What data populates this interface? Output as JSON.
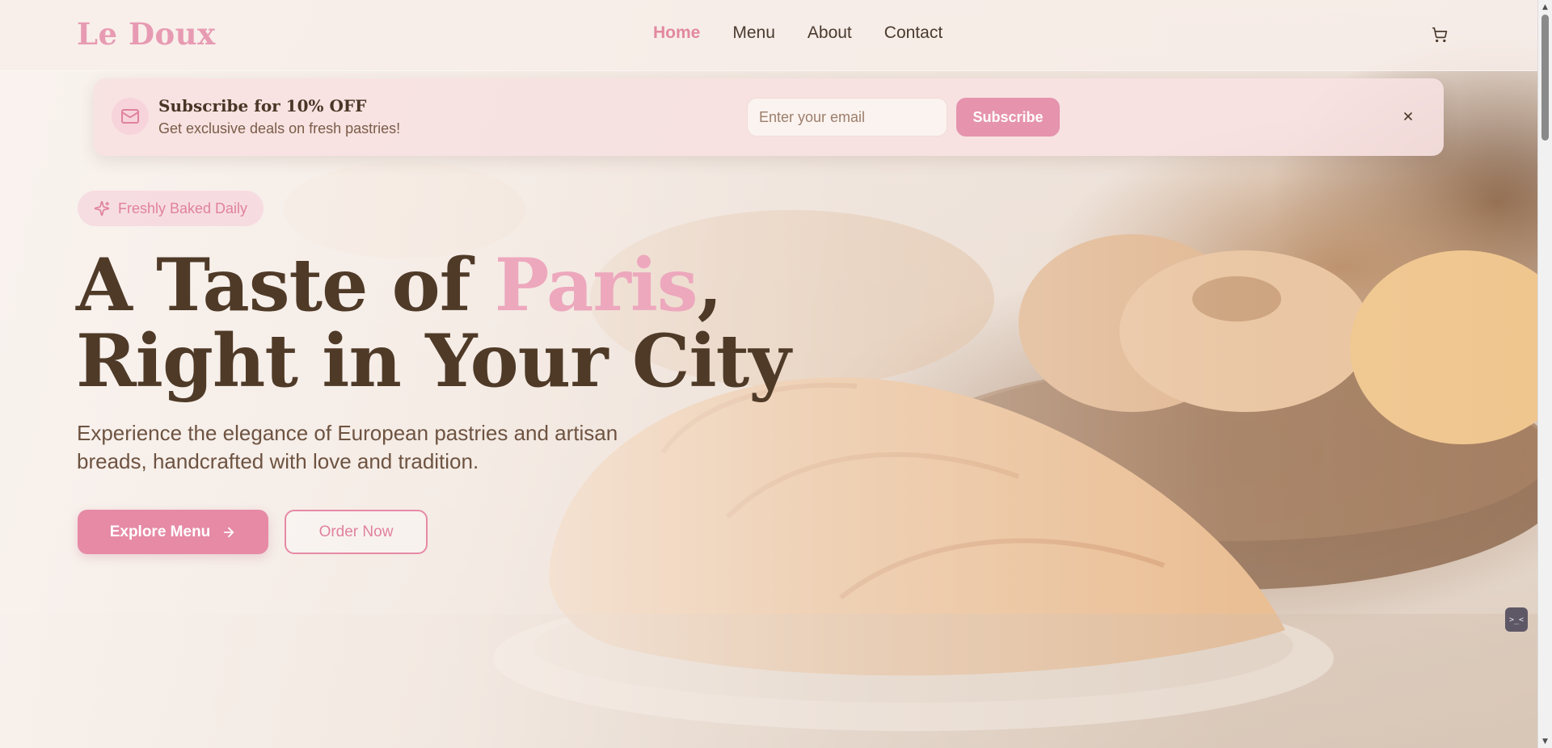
{
  "brand": {
    "logo": "Le Doux",
    "accent_color": "#e68aa6",
    "text_color": "#4f3a28"
  },
  "nav": {
    "items": [
      {
        "label": "Home",
        "active": true
      },
      {
        "label": "Menu",
        "active": false
      },
      {
        "label": "About",
        "active": false
      },
      {
        "label": "Contact",
        "active": false
      }
    ],
    "cart_icon": "shopping-cart-icon"
  },
  "banner": {
    "icon": "mail-icon",
    "title": "Subscribe for 10% OFF",
    "subtitle": "Get exclusive deals on fresh pastries!",
    "email_placeholder": "Enter your email",
    "email_value": "",
    "subscribe_label": "Subscribe",
    "close_icon": "close-icon"
  },
  "hero": {
    "badge_icon": "sparkles-icon",
    "badge_label": "Freshly Baked Daily",
    "title_part1": "A Taste of ",
    "title_highlight": "Paris",
    "title_part2": ",",
    "title_line2": "Right in Your City",
    "description": "Experience the elegance of European pastries and artisan breads, handcrafted with love and tradition.",
    "explore_label": "Explore Menu",
    "explore_icon": "arrow-right-icon",
    "order_label": "Order Now"
  },
  "widget": {
    "label": ">_<"
  }
}
